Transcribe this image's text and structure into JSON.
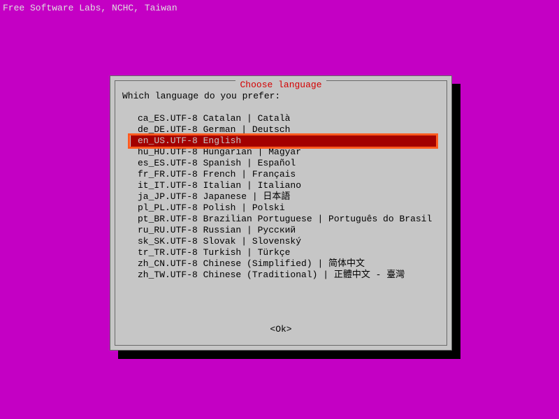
{
  "header": "Free Software Labs, NCHC, Taiwan",
  "dialog": {
    "title": "Choose language",
    "prompt": "Which language do you prefer:",
    "ok_label": "<Ok>"
  },
  "languages": [
    {
      "text": "ca_ES.UTF-8 Catalan | Català",
      "selected": false
    },
    {
      "text": "de_DE.UTF-8 German | Deutsch",
      "selected": false
    },
    {
      "text": "en_US.UTF-8 English",
      "selected": true
    },
    {
      "text": "hu_HU.UTF-8 Hungarian | Magyar",
      "selected": false
    },
    {
      "text": "es_ES.UTF-8 Spanish | Español",
      "selected": false
    },
    {
      "text": "fr_FR.UTF-8 French | Français",
      "selected": false
    },
    {
      "text": "it_IT.UTF-8 Italian | Italiano",
      "selected": false
    },
    {
      "text": "ja_JP.UTF-8 Japanese | 日本語",
      "selected": false
    },
    {
      "text": "pl_PL.UTF-8 Polish | Polski",
      "selected": false
    },
    {
      "text": "pt_BR.UTF-8 Brazilian Portuguese | Português do Brasil",
      "selected": false
    },
    {
      "text": "ru_RU.UTF-8 Russian | Русский",
      "selected": false
    },
    {
      "text": "sk_SK.UTF-8 Slovak | Slovenský",
      "selected": false
    },
    {
      "text": "tr_TR.UTF-8 Turkish | Türkçe",
      "selected": false
    },
    {
      "text": "zh_CN.UTF-8 Chinese (Simplified) | 简体中文",
      "selected": false
    },
    {
      "text": "zh_TW.UTF-8 Chinese (Traditional) | 正體中文 - 臺灣",
      "selected": false
    }
  ],
  "colors": {
    "background": "#c400c4",
    "dialog_bg": "#c6c6c6",
    "dialog_border": "#6a6a6a",
    "title_fg": "#d40000",
    "selected_bg": "#a30000",
    "annotation_border": "#ff5a1f"
  }
}
